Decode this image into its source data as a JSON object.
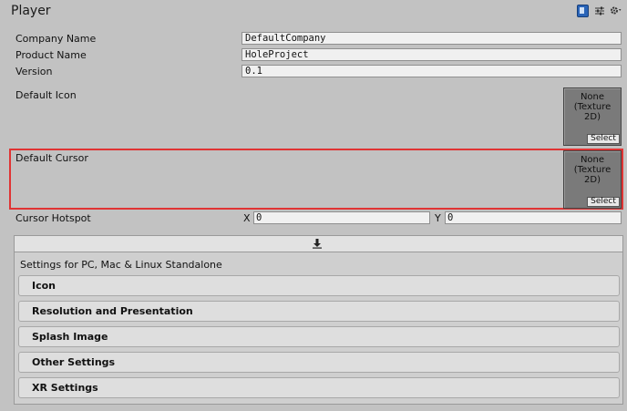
{
  "window": {
    "title": "Player"
  },
  "toolbar_icons": [
    "help-book-icon",
    "preset-sliders-icon",
    "settings-gear-icon"
  ],
  "fields": {
    "company_name": {
      "label": "Company Name",
      "value": "DefaultCompany"
    },
    "product_name": {
      "label": "Product Name",
      "value": "HoleProject"
    },
    "version": {
      "label": "Version",
      "value": "0.1"
    }
  },
  "default_icon": {
    "label": "Default Icon",
    "texture_text": "None\n(Texture\n2D)",
    "select_label": "Select"
  },
  "default_cursor": {
    "label": "Default Cursor",
    "texture_text": "None\n(Texture\n2D)",
    "select_label": "Select",
    "highlight_color": "#e03434"
  },
  "cursor_hotspot": {
    "label": "Cursor Hotspot",
    "x_label": "X",
    "x_value": "0",
    "y_label": "Y",
    "y_value": "0"
  },
  "platform": {
    "tab_icon": "download-arrow-icon",
    "settings_label": "Settings for PC, Mac & Linux Standalone",
    "sections": [
      {
        "label": "Icon"
      },
      {
        "label": "Resolution and Presentation"
      },
      {
        "label": "Splash Image"
      },
      {
        "label": "Other Settings"
      },
      {
        "label": "XR Settings"
      }
    ]
  }
}
